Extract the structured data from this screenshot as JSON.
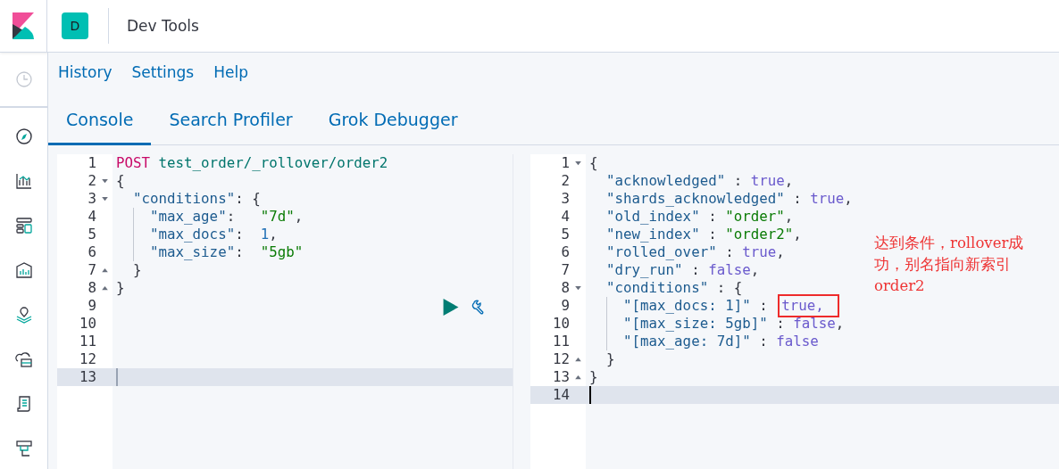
{
  "header": {
    "avatar": "D",
    "title": "Dev Tools"
  },
  "menu": [
    "History",
    "Settings",
    "Help"
  ],
  "tabs": [
    {
      "label": "Console",
      "selected": true
    },
    {
      "label": "Search Profiler",
      "selected": false
    },
    {
      "label": "Grok Debugger",
      "selected": false
    }
  ],
  "request": {
    "lines": [
      {
        "n": "1",
        "tokens": [
          {
            "t": "POST",
            "kind": "method"
          },
          {
            "t": " test_order/_rollover/order2",
            "kind": "url"
          }
        ]
      },
      {
        "n": "2",
        "fold_start": true,
        "tokens": [
          {
            "t": "{",
            "kind": "punct"
          }
        ]
      },
      {
        "n": "3",
        "fold_start": true,
        "tokens": [
          {
            "t": "  \"conditions\"",
            "kind": "key"
          },
          {
            "t": ": {",
            "kind": "punct"
          }
        ]
      },
      {
        "n": "4",
        "guide": true,
        "tokens": [
          {
            "t": "    \"max_age\"",
            "kind": "key"
          },
          {
            "t": ":   ",
            "kind": "punct"
          },
          {
            "t": "\"7d\"",
            "kind": "str"
          },
          {
            "t": ",",
            "kind": "punct"
          }
        ]
      },
      {
        "n": "5",
        "guide": true,
        "tokens": [
          {
            "t": "    \"max_docs\"",
            "kind": "key"
          },
          {
            "t": ":  ",
            "kind": "punct"
          },
          {
            "t": "1",
            "kind": "num"
          },
          {
            "t": ",",
            "kind": "punct"
          }
        ]
      },
      {
        "n": "6",
        "guide": true,
        "tokens": [
          {
            "t": "    \"max_size\"",
            "kind": "key"
          },
          {
            "t": ":  ",
            "kind": "punct"
          },
          {
            "t": "\"5gb\"",
            "kind": "str"
          }
        ]
      },
      {
        "n": "7",
        "fold_end": true,
        "tokens": [
          {
            "t": "  }",
            "kind": "punct"
          }
        ]
      },
      {
        "n": "8",
        "fold_end": true,
        "tokens": [
          {
            "t": "}",
            "kind": "punct"
          }
        ]
      },
      {
        "n": "9"
      },
      {
        "n": "10"
      },
      {
        "n": "11"
      },
      {
        "n": "12"
      },
      {
        "n": "13",
        "active": true
      }
    ]
  },
  "response": {
    "lines": [
      {
        "n": "1",
        "fold_start": true,
        "tokens": [
          {
            "t": "{",
            "kind": "punct"
          }
        ]
      },
      {
        "n": "2",
        "tokens": [
          {
            "t": "  \"acknowledged\"",
            "kind": "key"
          },
          {
            "t": " : ",
            "kind": "punct"
          },
          {
            "t": "true",
            "kind": "bool"
          },
          {
            "t": ",",
            "kind": "punct"
          }
        ]
      },
      {
        "n": "3",
        "tokens": [
          {
            "t": "  \"shards_acknowledged\"",
            "kind": "key"
          },
          {
            "t": " : ",
            "kind": "punct"
          },
          {
            "t": "true",
            "kind": "bool"
          },
          {
            "t": ",",
            "kind": "punct"
          }
        ]
      },
      {
        "n": "4",
        "tokens": [
          {
            "t": "  \"old_index\"",
            "kind": "key"
          },
          {
            "t": " : ",
            "kind": "punct"
          },
          {
            "t": "\"order\"",
            "kind": "str"
          },
          {
            "t": ",",
            "kind": "punct"
          }
        ]
      },
      {
        "n": "5",
        "tokens": [
          {
            "t": "  \"new_index\"",
            "kind": "key"
          },
          {
            "t": " : ",
            "kind": "punct"
          },
          {
            "t": "\"order2\"",
            "kind": "str"
          },
          {
            "t": ",",
            "kind": "punct"
          }
        ]
      },
      {
        "n": "6",
        "tokens": [
          {
            "t": "  \"rolled_over\"",
            "kind": "key"
          },
          {
            "t": " : ",
            "kind": "punct"
          },
          {
            "t": "true",
            "kind": "bool"
          },
          {
            "t": ",",
            "kind": "punct"
          }
        ]
      },
      {
        "n": "7",
        "tokens": [
          {
            "t": "  \"dry_run\"",
            "kind": "key"
          },
          {
            "t": " : ",
            "kind": "punct"
          },
          {
            "t": "false",
            "kind": "bool"
          },
          {
            "t": ",",
            "kind": "punct"
          }
        ]
      },
      {
        "n": "8",
        "fold_start": true,
        "tokens": [
          {
            "t": "  \"conditions\"",
            "kind": "key"
          },
          {
            "t": " : {",
            "kind": "punct"
          }
        ]
      },
      {
        "n": "9",
        "guide": true,
        "tokens": [
          {
            "t": "    \"[max_docs: 1]\"",
            "kind": "key"
          },
          {
            "t": " : ",
            "kind": "punct"
          },
          {
            "t": "true,",
            "kind": "bool",
            "boxed": true
          }
        ]
      },
      {
        "n": "10",
        "guide": true,
        "tokens": [
          {
            "t": "    \"[max_size: 5gb]\"",
            "kind": "key"
          },
          {
            "t": " : ",
            "kind": "punct"
          },
          {
            "t": "false",
            "kind": "bool"
          },
          {
            "t": ",",
            "kind": "punct"
          }
        ]
      },
      {
        "n": "11",
        "guide": true,
        "tokens": [
          {
            "t": "    \"[max_age: 7d]\"",
            "kind": "key"
          },
          {
            "t": " : ",
            "kind": "punct"
          },
          {
            "t": "false",
            "kind": "bool"
          }
        ]
      },
      {
        "n": "12",
        "fold_end": true,
        "tokens": [
          {
            "t": "  }",
            "kind": "punct"
          }
        ]
      },
      {
        "n": "13",
        "fold_end": true,
        "tokens": [
          {
            "t": "}",
            "kind": "punct"
          }
        ]
      },
      {
        "n": "14",
        "active": true
      }
    ]
  },
  "annotation": "达到条件，rollover成功，别名指向新索引order2"
}
